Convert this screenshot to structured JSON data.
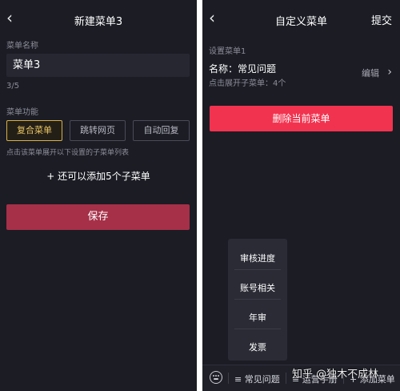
{
  "left": {
    "back_icon": "chevron-left-icon",
    "title": "新建菜单3",
    "name_label": "菜单名称",
    "name_value": "菜单3",
    "char_count": "3/5",
    "function_label": "菜单功能",
    "function_options": [
      "复合菜单",
      "跳转网页",
      "自动回复"
    ],
    "selected_option": "复合菜单",
    "hint": "点击该菜单展开以下设置的子菜单列表",
    "add_more": "+ 还可以添加5个子菜单",
    "save_label": "保存",
    "colors": {
      "accent_gold": "#e9c565",
      "save": "#a53048",
      "background": "#1b1c24"
    }
  },
  "right": {
    "back_icon": "chevron-left-icon",
    "title": "自定义菜单",
    "submit_label": "提交",
    "section_label": "设置菜单1",
    "menu_name": "名称：常见问题",
    "menu_sub": "点击展开子菜单：4个",
    "edit_label": "编辑",
    "delete_label": "删除当前菜单",
    "popup_items": [
      "审核进度",
      "账号相关",
      "年审",
      "发票"
    ],
    "bottom_bar": {
      "keyboard_icon": "keyboard-icon",
      "item1": "≡ 常见问题",
      "item2": "≡ 运营手册",
      "item3": "+ 添加菜单"
    },
    "watermark": "知乎 @独木不成林",
    "colors": {
      "delete": "#f2334f"
    }
  }
}
